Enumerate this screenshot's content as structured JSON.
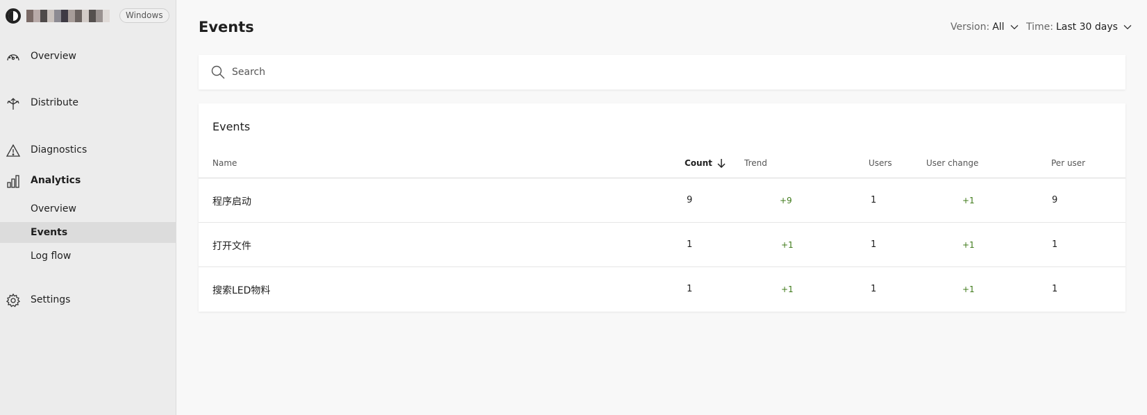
{
  "app": {
    "platform": "Windows",
    "obscured_name_colors": [
      "#7a6a66",
      "#b8aaa8",
      "#4f4a4a",
      "#c9c1bd",
      "#8c8a92",
      "#3e3a44",
      "#a79d99",
      "#6b6360",
      "#d3ccc8",
      "#55504e",
      "#9a9290",
      "#e0dbd8"
    ]
  },
  "sidebar": {
    "items": [
      {
        "label": "Overview",
        "icon": "gauge-icon"
      },
      {
        "label": "Distribute",
        "icon": "distribute-icon"
      },
      {
        "label": "Diagnostics",
        "icon": "warning-icon"
      },
      {
        "label": "Analytics",
        "icon": "bar-chart-icon"
      },
      {
        "label": "Settings",
        "icon": "gear-icon"
      }
    ],
    "analytics_sub": [
      {
        "label": "Overview",
        "active": false
      },
      {
        "label": "Events",
        "active": true
      },
      {
        "label": "Log flow",
        "active": false
      }
    ]
  },
  "header": {
    "title": "Events",
    "version_filter": {
      "label": "Version:",
      "value": "All"
    },
    "time_filter": {
      "label": "Time:",
      "value": "Last 30 days"
    }
  },
  "search": {
    "placeholder": "Search",
    "value": ""
  },
  "events_table": {
    "title": "Events",
    "columns": [
      "Name",
      "Count",
      "Trend",
      "Users",
      "User change",
      "Per user"
    ],
    "sorted_column": "Count",
    "rows": [
      {
        "name": "程序启动",
        "count": "9",
        "trend": "+9",
        "users": "1",
        "user_change": "+1",
        "per_user": "9"
      },
      {
        "name": "打开文件",
        "count": "1",
        "trend": "+1",
        "users": "1",
        "user_change": "+1",
        "per_user": "1"
      },
      {
        "name": "搜索LED物料",
        "count": "1",
        "trend": "+1",
        "users": "1",
        "user_change": "+1",
        "per_user": "1"
      }
    ]
  },
  "colors": {
    "positive_delta": "#3f7a1a",
    "sidebar_bg": "#ececec",
    "active_item_bg": "#dcdcdc"
  }
}
